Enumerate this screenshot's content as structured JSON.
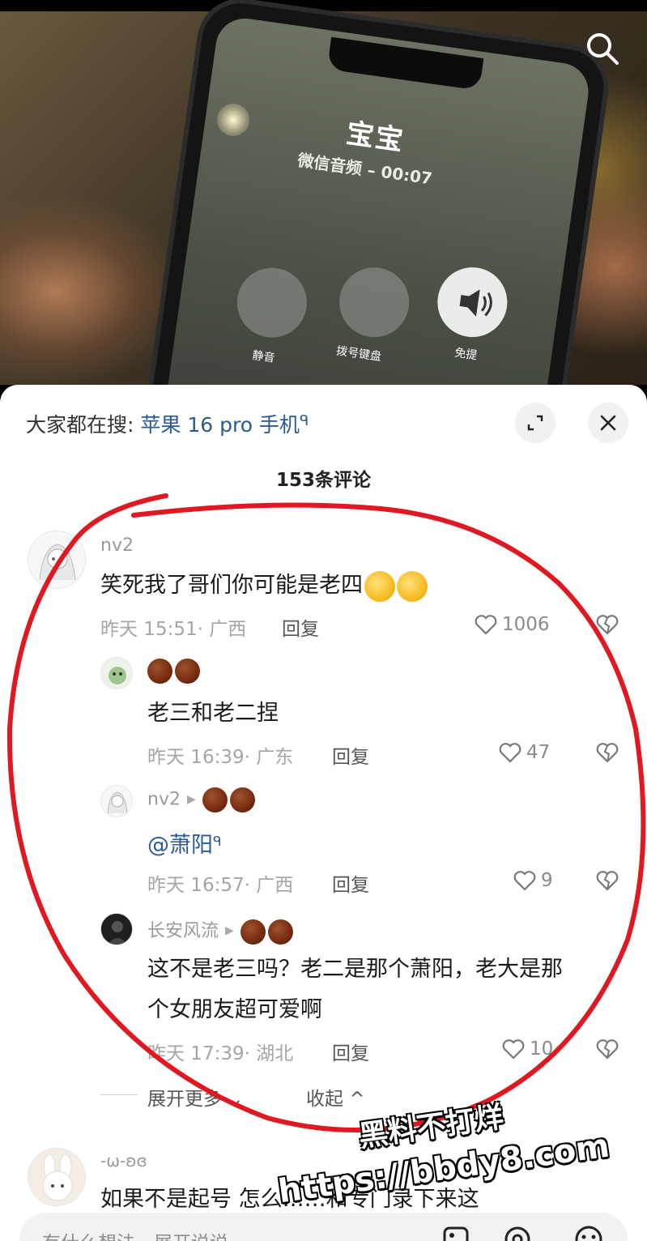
{
  "video": {
    "call_name": "宝宝",
    "call_status": "微信音频 – 00:07",
    "btn_mute": "静音",
    "btn_keypad": "拨号键盘",
    "btn_speaker": "免提"
  },
  "header": {
    "hot_search_prefix": "大家都在搜:",
    "hot_search_keyword": "苹果 16 pro 手机"
  },
  "comment_count": "153条评论",
  "comments": [
    {
      "username": "nv2",
      "text": "笑死我了哥们你可能是老四",
      "time_location": "昨天 15:51· 广西",
      "reply_label": "回复",
      "likes": "1006"
    }
  ],
  "replies": [
    {
      "username": "",
      "text": "老三和老二捏",
      "time_location": "昨天 16:39· 广东",
      "reply_label": "回复",
      "likes": "47"
    },
    {
      "username": "nv2",
      "mention": "@萧阳",
      "time_location": "昨天 16:57· 广西",
      "reply_label": "回复",
      "likes": "9"
    },
    {
      "username": "长安风流",
      "text_line1": "这不是老三吗？老二是那个萧阳，老大是那",
      "text_line2": "个女朋友超可爱啊",
      "time_location": "昨天 17:39· 湖北",
      "reply_label": "回复",
      "likes": "10"
    }
  ],
  "expand": {
    "more_label": "展开更多",
    "collapse_label": "收起"
  },
  "next_comment": {
    "username": "-ω-ʚɞ",
    "text": "如果不是起号 怎么……和专门录下来这"
  },
  "input": {
    "placeholder": "有什么想法，展开说说"
  },
  "watermark": {
    "line1": "黑料不打烊",
    "line2": "https://bbdy8.com"
  }
}
